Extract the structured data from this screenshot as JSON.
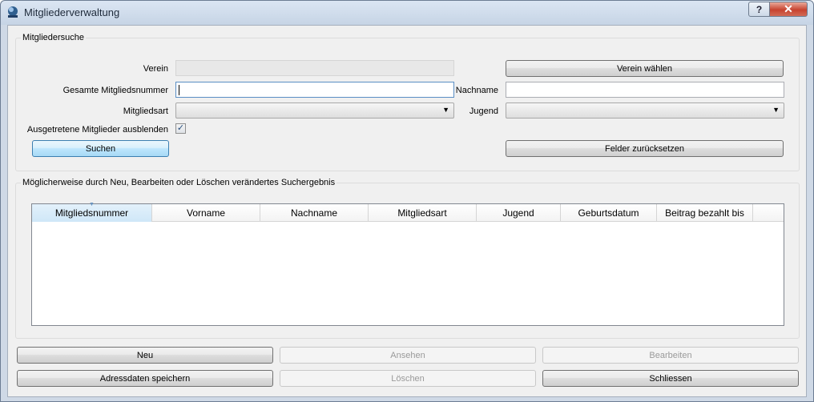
{
  "window": {
    "title": "Mitgliederverwaltung",
    "help_label": "?",
    "close_label": "✕"
  },
  "search": {
    "group_title": "Mitgliedersuche",
    "verein_label": "Verein",
    "verein_value": "",
    "verein_button": "Verein wählen",
    "mitgliedsnummer_label": "Gesamte Mitgliedsnummer",
    "mitgliedsnummer_value": "",
    "nachname_label": "Nachname",
    "nachname_value": "",
    "mitgliedsart_label": "Mitgliedsart",
    "mitgliedsart_value": "",
    "jugend_label": "Jugend",
    "jugend_value": "",
    "ausgetretene_label": "Ausgetretene Mitglieder ausblenden",
    "ausgetretene_checked": "✓",
    "search_button": "Suchen",
    "reset_button": "Felder zurücksetzen"
  },
  "results": {
    "group_title": "Möglicherweise durch Neu, Bearbeiten oder Löschen verändertes Suchergebnis",
    "columns": [
      "Mitgliedsnummer",
      "Vorname",
      "Nachname",
      "Mitgliedsart",
      "Jugend",
      "Geburtsdatum",
      "Beitrag bezahlt bis"
    ],
    "sort_indicator": "▼",
    "rows": []
  },
  "actions": {
    "neu": "Neu",
    "ansehen": "Ansehen",
    "bearbeiten": "Bearbeiten",
    "adressdaten": "Adressdaten speichern",
    "loeschen": "Löschen",
    "schliessen": "Schliessen"
  },
  "colors": {
    "accent": "#3c7fb1",
    "close": "#c7432f",
    "titlebar": "#c6d4e5"
  },
  "icons": {
    "app": "globe-icon",
    "dropdown": "chevron-down-icon",
    "sort": "sort-down-icon"
  }
}
